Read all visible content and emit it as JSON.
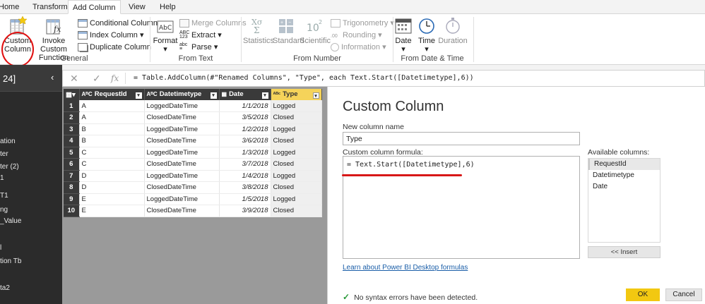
{
  "tabs": [
    "Home",
    "Transform",
    "Add Column",
    "View",
    "Help"
  ],
  "ribbon": {
    "general": {
      "label": "General",
      "custom_column": [
        "Custom",
        "Column"
      ],
      "invoke_custom_function": [
        "Invoke Custom",
        "Function"
      ],
      "conditional_column": "Conditional Column",
      "index_column": "Index Column",
      "duplicate_column": "Duplicate Column"
    },
    "from_text": {
      "label": "From Text",
      "format": "Format",
      "merge_columns": "Merge Columns",
      "extract": "Extract",
      "parse": "Parse"
    },
    "from_number": {
      "label": "From Number",
      "statistics": "Statistics",
      "standard": "Standard",
      "scientific": "Scientific",
      "trigonometry": "Trigonometry",
      "rounding": "Rounding",
      "information": "Information"
    },
    "from_date_time": {
      "label": "From Date & Time",
      "date": "Date",
      "time": "Time",
      "duration": "Duration"
    }
  },
  "left_panel": {
    "header": "24]",
    "items": [
      "ation",
      "ter",
      "ter (2)",
      "1",
      "T1",
      "ng",
      "_Value",
      "l",
      "tion Tb",
      "ta2"
    ]
  },
  "formula_bar": {
    "formula": "= Table.AddColumn(#\"Renamed Columns\", \"Type\", each Text.Start([Datetimetype],6))"
  },
  "grid": {
    "columns": [
      {
        "icon": "ABC",
        "name": "RequestId"
      },
      {
        "icon": "ABC",
        "name": "Datetimetype"
      },
      {
        "icon": "cal",
        "name": "Date"
      },
      {
        "icon": "ABC123",
        "name": "Type"
      }
    ],
    "rows": [
      {
        "n": "1",
        "requestid": "A",
        "datetimetype": "LoggedDateTime",
        "date": "1/1/2018",
        "type": "Logged"
      },
      {
        "n": "2",
        "requestid": "A",
        "datetimetype": "ClosedDateTime",
        "date": "3/5/2018",
        "type": "Closed"
      },
      {
        "n": "3",
        "requestid": "B",
        "datetimetype": "LoggedDateTime",
        "date": "1/2/2018",
        "type": "Logged"
      },
      {
        "n": "4",
        "requestid": "B",
        "datetimetype": "ClosedDateTime",
        "date": "3/6/2018",
        "type": "Closed"
      },
      {
        "n": "5",
        "requestid": "C",
        "datetimetype": "LoggedDateTime",
        "date": "1/3/2018",
        "type": "Logged"
      },
      {
        "n": "6",
        "requestid": "C",
        "datetimetype": "ClosedDateTime",
        "date": "3/7/2018",
        "type": "Closed"
      },
      {
        "n": "7",
        "requestid": "D",
        "datetimetype": "LoggedDateTime",
        "date": "1/4/2018",
        "type": "Logged"
      },
      {
        "n": "8",
        "requestid": "D",
        "datetimetype": "ClosedDateTime",
        "date": "3/8/2018",
        "type": "Closed"
      },
      {
        "n": "9",
        "requestid": "E",
        "datetimetype": "LoggedDateTime",
        "date": "1/5/2018",
        "type": "Logged"
      },
      {
        "n": "10",
        "requestid": "E",
        "datetimetype": "ClosedDateTime",
        "date": "3/9/2018",
        "type": "Closed"
      }
    ]
  },
  "dialog": {
    "title": "Custom Column",
    "new_column_name_label": "New column name",
    "new_column_name_value": "Type",
    "formula_label": "Custom column formula:",
    "formula_value": "= Text.Start([Datetimetype],6)",
    "available_columns_label": "Available columns:",
    "available_columns": [
      "RequestId",
      "Datetimetype",
      "Date"
    ],
    "insert_label": "<< Insert",
    "learn_link": "Learn about Power BI Desktop formulas",
    "status": "No syntax errors have been detected.",
    "ok_label": "OK",
    "cancel_label": "Cancel"
  },
  "colors": {
    "accent_yellow": "#f2c811",
    "annotation_red": "#d81818",
    "dark_panel": "#2b2b2b",
    "status_green": "#2a9a3a"
  }
}
